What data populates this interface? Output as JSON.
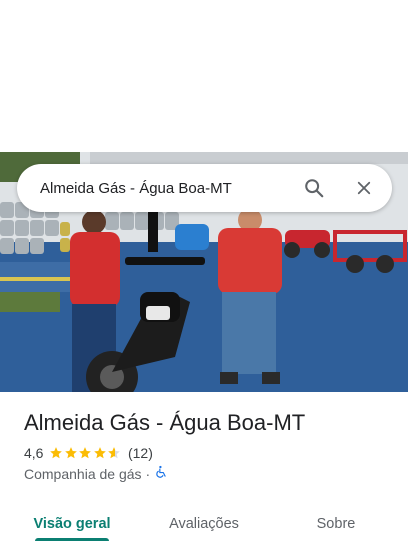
{
  "search": {
    "query": "Almeida Gás - Água Boa-MT"
  },
  "icons": {
    "search": "search-icon",
    "close": "close-icon",
    "accessibility": "wheelchair-icon",
    "star": "star-icon"
  },
  "place": {
    "name": "Almeida Gás - Água Boa-MT",
    "rating": "4,6",
    "stars": 4.6,
    "review_count": "(12)",
    "category": "Companhia de gás",
    "separator": "·"
  },
  "tabs": [
    {
      "label": "Visão geral",
      "selected": true
    },
    {
      "label": "Avaliações",
      "selected": false
    },
    {
      "label": "Sobre",
      "selected": false
    }
  ],
  "colors": {
    "accent": "#0b7f72",
    "star": "#fbbc04",
    "accessibility": "#1a73e8",
    "text": "#202124",
    "secondary": "#5f6368"
  }
}
